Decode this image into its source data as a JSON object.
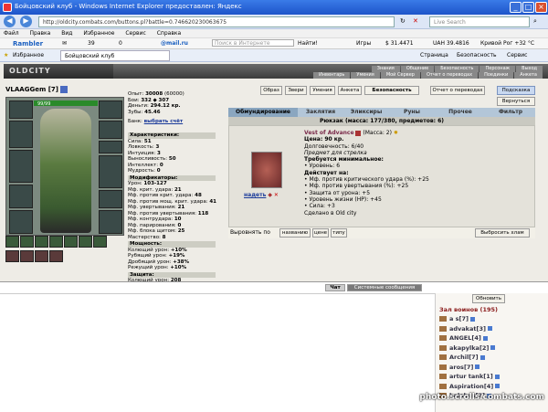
{
  "window": {
    "title": "Бойцовский клуб - Windows Internet Explorer предоставлен: Яндекс"
  },
  "address": {
    "url": "http://oldcity.combats.com/buttons.pl?battle=0.746620230063675",
    "search_placeholder": "Live Search"
  },
  "menu": [
    "Файл",
    "Правка",
    "Вид",
    "Избранное",
    "Сервис",
    "Справка"
  ],
  "toolbar": {
    "rambler": "Rambler",
    "counter1": "39",
    "counter2": "0",
    "mail": "@mail.ru",
    "search_placeholder": "Поиск в Интернете",
    "find": "Найти!",
    "games": "Игры",
    "usd": "$ 31.4471",
    "uah": "UAH 39.4816",
    "weather": "Кривой Рог +32 °C"
  },
  "favbar": {
    "favorites": "Избранное",
    "tab": "Бойцовский клуб",
    "page": "Страница",
    "safety": "Безопасность",
    "service": "Сервис"
  },
  "game": {
    "logo": "OLDCITY",
    "nav_top": [
      "Знания",
      "Общение",
      "Безопасность",
      "Персонаж",
      "Выход"
    ],
    "nav_bottom": [
      "Инвентарь",
      "Умения",
      "Мой Сервер",
      "Отчет о переводах",
      "Поединки",
      "Анкета"
    ],
    "char": {
      "name": "VLAAGGem",
      "level": "[7]",
      "hp": "99/99"
    },
    "stats": {
      "exp": "Опыт:",
      "exp_val": "30008",
      "exp_next": "(60000)",
      "battles": "Бои:",
      "battles_win": "332",
      "battles_lose": "307",
      "money": "Деньги:",
      "money_val": "294.12 кр.",
      "teeth": "Зубы:",
      "teeth_val": "45.46"
    },
    "bank": "Банк:",
    "bank_link": "выбрать счёт",
    "sections": {
      "characteristics": "Характеристики:",
      "modifiers": "Модификаторы:",
      "power": "Мощность:",
      "protection": "Защита:"
    },
    "characteristics": [
      [
        "Сила:",
        "51"
      ],
      [
        "Ловкость:",
        "3"
      ],
      [
        "Интуиция:",
        "3"
      ],
      [
        "Выносливость:",
        "50"
      ],
      [
        "Интеллект:",
        "0"
      ],
      [
        "Мудрость:",
        "0"
      ]
    ],
    "modifiers": [
      [
        "Урон:",
        "103-127"
      ],
      [
        "Мф. крит. удара:",
        "21"
      ],
      [
        "Мф. против крит. удара:",
        "48"
      ],
      [
        "Мф. против мощ. крит. удара:",
        "41"
      ],
      [
        "Мф. увертывания:",
        "21"
      ],
      [
        "Мф. против увертывания:",
        "118"
      ],
      [
        "Мф. контрудара:",
        "10"
      ],
      [
        "Мф. парирования:",
        "0"
      ],
      [
        "Мф. блока щитом:",
        "25"
      ],
      [
        "Мастерство:",
        "8"
      ]
    ],
    "power": [
      [
        "Колющий урон:",
        "+10%"
      ],
      [
        "Рубящий урон:",
        "+19%"
      ],
      [
        "Дробящий урон:",
        "+38%"
      ],
      [
        "Режущий урон:",
        "+10%"
      ]
    ],
    "protection": [
      [
        "Колющий урон:",
        "208"
      ]
    ],
    "buttons": [
      "Образ",
      "Звери",
      "Умения",
      "Анкета",
      "Безопасность",
      "Отчет о переводах"
    ],
    "help": "Подсказка",
    "back": "Вернуться",
    "tabs": [
      "Обмундирование",
      "Заклятия",
      "Эликсиры",
      "Руны",
      "Прочее",
      "Фильтр"
    ],
    "backpack": "Рюкзак (масса: 177/380, предметов: 6)",
    "item": {
      "name": "Vest of Advance",
      "mass": "(Масса: 2)",
      "price": "Цена: 90 кр.",
      "durability": "Долговечность: 6/40",
      "purpose": "Предмет для стрелка",
      "req_title": "Требуется минимальное:",
      "req_level": "• Уровень: 6",
      "acts_title": "Действует на:",
      "act1": "• Мф. против критического удара (%): +25",
      "act2": "• Мф. против увертывания (%): +25",
      "act3": "• Защита от урона: +5",
      "act4": "• Уровень жизни (HP): +45",
      "act5": "• Сила: +3",
      "made": "Сделано в Old city",
      "wear": "надеть"
    },
    "sort": {
      "label": "Выровнять по",
      "by_name": "названию",
      "by_price": "цене",
      "by_type": "типу",
      "throw": "Выбросить хлам"
    }
  },
  "chat": {
    "tabs": [
      "Чат",
      "Системные сообщения"
    ],
    "refresh": "Обновить",
    "hall": "Зал воинов",
    "hall_count": "(195)",
    "users": [
      [
        "a s",
        "[7]"
      ],
      [
        "advakat",
        "[3]"
      ],
      [
        "ANGEL",
        "[4]"
      ],
      [
        "akapylka",
        "[2]"
      ],
      [
        "Archil",
        "[7]"
      ],
      [
        "aros",
        "[7]"
      ],
      [
        "artur tank",
        "[1]"
      ],
      [
        "Aspiration",
        "[4]"
      ],
      [
        "balabas",
        "[7]"
      ]
    ]
  },
  "watermark": "photo.scrolls.combats.com"
}
